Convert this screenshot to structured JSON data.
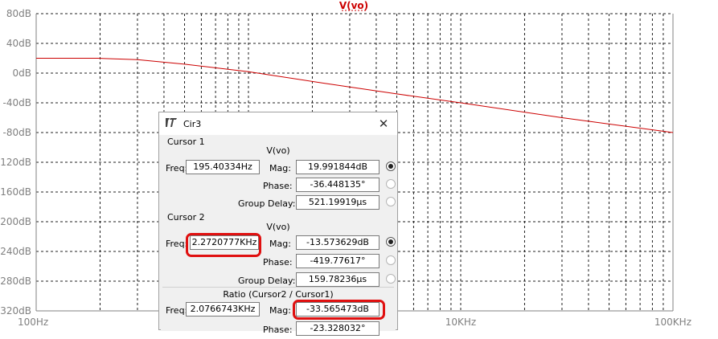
{
  "plot": {
    "title": "V(vo)",
    "y_ticks": [
      "80dB",
      "40dB",
      "0dB",
      "-40dB",
      "-80dB",
      "-120dB",
      "-160dB",
      "-200dB",
      "-240dB",
      "-280dB",
      "-320dB"
    ],
    "x_ticks": [
      "100Hz",
      "1KHz",
      "10KHz",
      "100KHz"
    ],
    "colors": {
      "trace": "#cc0000",
      "grid": "#202020",
      "axis_text": "#808080"
    }
  },
  "chart_data": {
    "type": "line",
    "title": "V(vo)",
    "xscale": "log",
    "xlim_hz": [
      100,
      100000
    ],
    "ylim_db": [
      -320,
      80
    ],
    "series": [
      {
        "name": "V(vo)",
        "x_hz": [
          100,
          150,
          195,
          300,
          500,
          1000,
          2272,
          5000,
          10000,
          30000,
          100000
        ],
        "y_db": [
          20,
          20,
          20,
          18,
          12,
          2,
          -13.6,
          -28,
          -40,
          -60,
          -80
        ]
      }
    ],
    "cursors": [
      {
        "name": "Cursor 1",
        "freq_hz": 195.40334,
        "mag_db": 19.991844
      },
      {
        "name": "Cursor 2",
        "freq_hz": 2272.0777,
        "mag_db": -13.573629
      }
    ]
  },
  "dialog": {
    "title": "Cir3",
    "close": "✕",
    "cursor1": {
      "header": "Cursor 1",
      "signal": "V(vo)",
      "freq_label": "Freq:",
      "freq": "195.40334Hz",
      "mag_label": "Mag:",
      "mag": "19.991844dB",
      "phase_label": "Phase:",
      "phase": "-36.448135°",
      "gd_label": "Group Delay:",
      "gd": "521.19919µs"
    },
    "cursor2": {
      "header": "Cursor 2",
      "signal": "V(vo)",
      "freq_label": "Freq:",
      "freq": "2.2720777KHz",
      "mag_label": "Mag:",
      "mag": "-13.573629dB",
      "phase_label": "Phase:",
      "phase": "-419.77617°",
      "gd_label": "Group Delay:",
      "gd": "159.78236µs"
    },
    "ratio": {
      "header": "Ratio (Cursor2 / Cursor1)",
      "freq_label": "Freq:",
      "freq": "2.0766743KHz",
      "mag_label": "Mag:",
      "mag": "-33.565473dB",
      "phase_label": "Phase:",
      "phase": "-23.328032°"
    }
  }
}
